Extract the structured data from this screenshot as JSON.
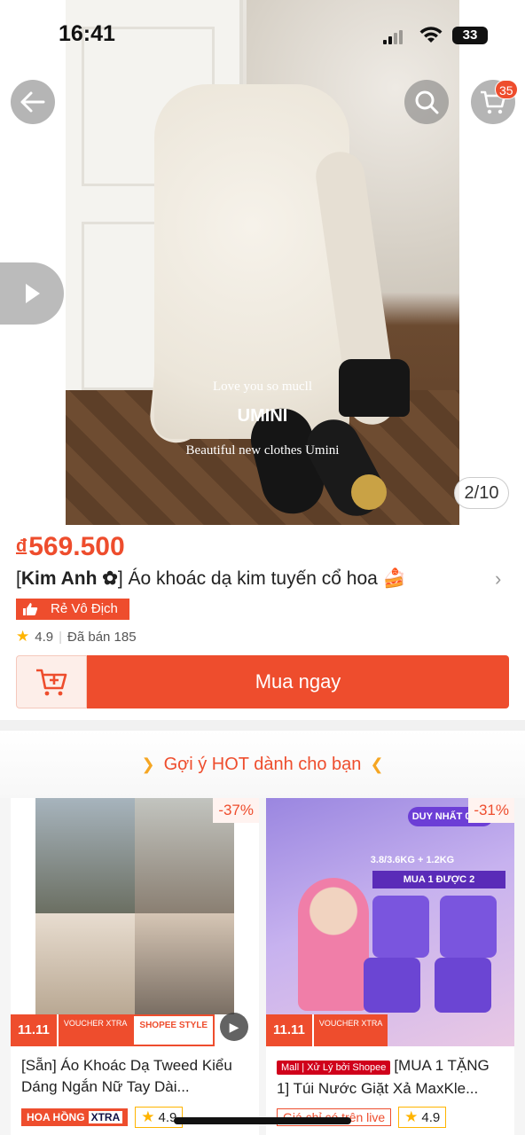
{
  "status_bar": {
    "time": "16:41",
    "battery": "33"
  },
  "header": {
    "cart_count": "35"
  },
  "gallery": {
    "counter": "2/10",
    "watermark_line1": "Love you so mucll",
    "watermark_brand": "UMINI",
    "watermark_line2": "Beautiful new clothes Umini"
  },
  "product": {
    "currency": "đ",
    "price": "569.500",
    "shop_name": "Kim Anh ✿",
    "title": " Áo khoác dạ kim tuyến cổ hoa 🍰",
    "tag": "Rẻ Vô Địch",
    "rating": "4.9",
    "sold": "Đã bán 185"
  },
  "actions": {
    "buy_now": "Mua ngay"
  },
  "suggestions": {
    "heading": "Gợi ý HOT dành cho bạn",
    "items": [
      {
        "discount": "-37%",
        "ribbon1": "11.11",
        "ribbon2": "VOUCHER XTRA",
        "ribbon3": "SHOPEE STYLE",
        "name": "[Sẵn] Áo Khoác Dạ Tweed Kiểu Dáng Ngắn Nữ Tay Dài...",
        "badge": "HOA HỒNG",
        "badge2": "XTRA",
        "rating": "4.9"
      },
      {
        "discount": "-31%",
        "ribbon1": "11.11",
        "ribbon2": "VOUCHER XTRA",
        "mall_tag": "Mall | Xử Lý bởi Shopee",
        "name": "[MUA 1 TẶNG 1] Túi Nước Giặt Xả MaxKle...",
        "live": "Giá chỉ có trên live",
        "rating": "4.9",
        "promo_header": "DUY NHẤT 01/11",
        "promo_weight": "3.8/3.6KG + 1.2KG",
        "promo_deal": "MUA 1 ĐƯỢC 2"
      }
    ]
  }
}
